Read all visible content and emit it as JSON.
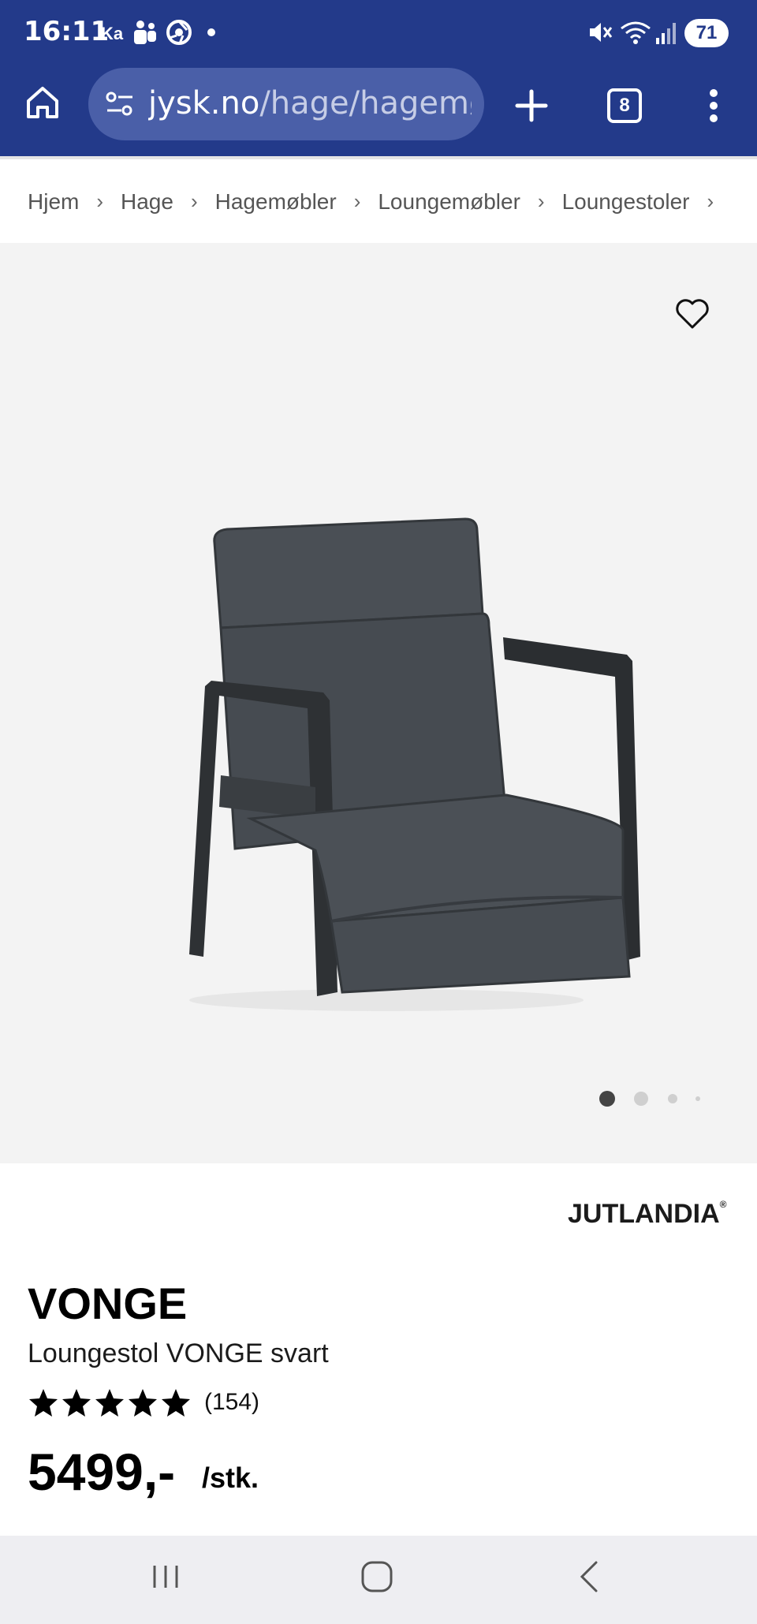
{
  "status_bar": {
    "time": "16:11",
    "carrier_badge": "Ka",
    "battery": "71"
  },
  "browser": {
    "url_domain": "jysk.no",
    "url_path": "/hage/hagemøbler",
    "tab_count": "8"
  },
  "breadcrumb": [
    {
      "label": "Hjem"
    },
    {
      "label": "Hage"
    },
    {
      "label": "Hagemøbler"
    },
    {
      "label": "Loungemøbler"
    },
    {
      "label": "Loungestoler"
    }
  ],
  "gallery": {
    "image_count": 4,
    "active_index": 0
  },
  "product": {
    "brand": "JUTLANDIA",
    "brand_mark": "®",
    "title": "VONGE",
    "subtitle": "Loungestol VONGE svart",
    "rating": 5,
    "review_count": "(154)",
    "price": "5499,-",
    "unit": "/stk."
  },
  "colors": {
    "header_blue": "#233a8a",
    "urlbar_blue": "#4a5fa8",
    "gallery_bg": "#f3f3f3",
    "chair_dark": "#3a3e42"
  }
}
